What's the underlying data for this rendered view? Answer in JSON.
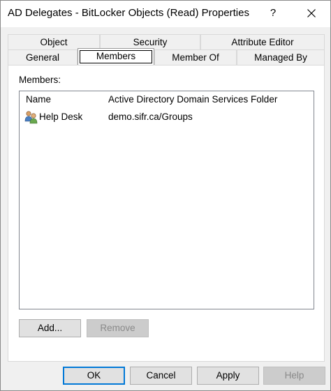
{
  "window": {
    "title": "AD Delegates - BitLocker Objects (Read) Properties",
    "help_glyph": "?"
  },
  "tabs": {
    "row_back": [
      "Object",
      "Security",
      "Attribute Editor"
    ],
    "row_front": [
      "General",
      "Members",
      "Member Of",
      "Managed By"
    ],
    "active": "Members"
  },
  "members": {
    "label": "Members:",
    "columns": [
      "Name",
      "Active Directory Domain Services Folder"
    ],
    "rows": [
      {
        "name": "Help Desk",
        "folder": "demo.sifr.ca/Groups",
        "icon": "group-icon"
      }
    ]
  },
  "buttons": {
    "add": "Add...",
    "remove": "Remove",
    "ok": "OK",
    "cancel": "Cancel",
    "apply": "Apply",
    "help": "Help"
  }
}
